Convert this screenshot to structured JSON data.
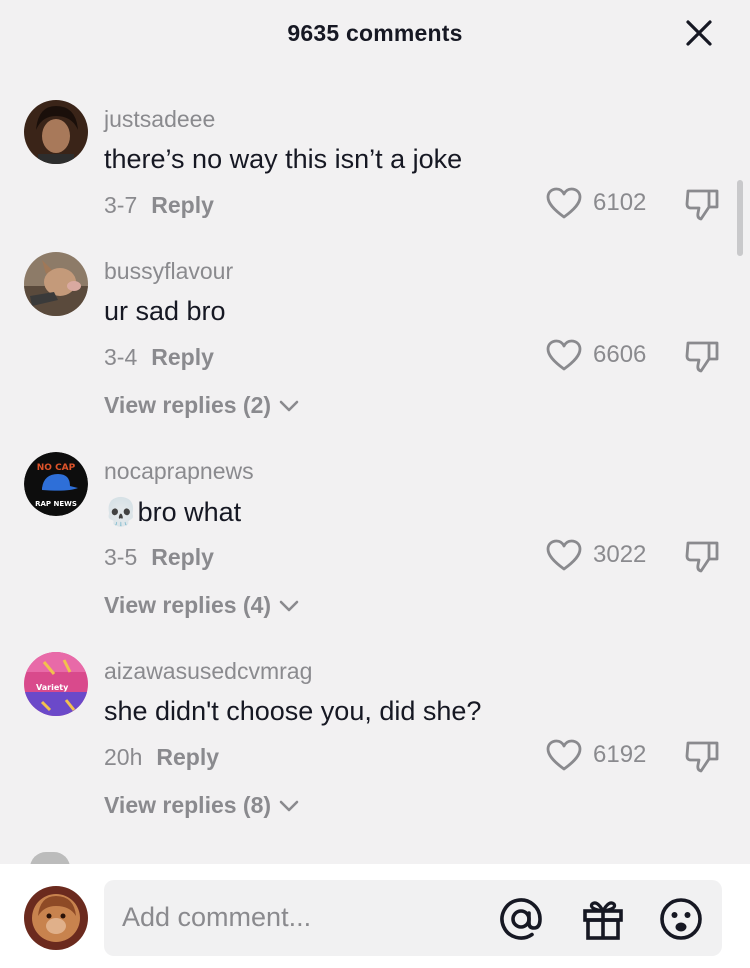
{
  "header": {
    "title": "9635 comments",
    "close_icon": "close-icon"
  },
  "comments": [
    {
      "username": "justsadeee",
      "text": "there’s no way this isn’t a joke",
      "date": "3-7",
      "reply_label": "Reply",
      "likes": "6102",
      "view_replies": ""
    },
    {
      "username": "bussyflavour",
      "text": "ur sad bro",
      "date": "3-4",
      "reply_label": "Reply",
      "likes": "6606",
      "view_replies": "View replies (2)"
    },
    {
      "username": "nocaprapnews",
      "emoji": "💀",
      "text": "bro what",
      "date": "3-5",
      "reply_label": "Reply",
      "likes": "3022",
      "view_replies": "View replies (4)"
    },
    {
      "username": "aizawasusedcvmrag",
      "text": "she didn't choose you, did she?",
      "date": "20h",
      "reply_label": "Reply",
      "likes": "6192",
      "view_replies": "View replies (8)"
    }
  ],
  "avatar_badges": {
    "nocap_top": "NO CAP",
    "nocap_bottom": "RAP NEWS",
    "variety": "Variety"
  },
  "footer": {
    "placeholder": "Add comment...",
    "icons": [
      "at-mention-icon",
      "gift-icon",
      "emoji-icon"
    ]
  },
  "colors": {
    "background": "#f2f1f2",
    "text": "#161823",
    "muted": "#8a8a8e",
    "footer": "#ffffff"
  }
}
